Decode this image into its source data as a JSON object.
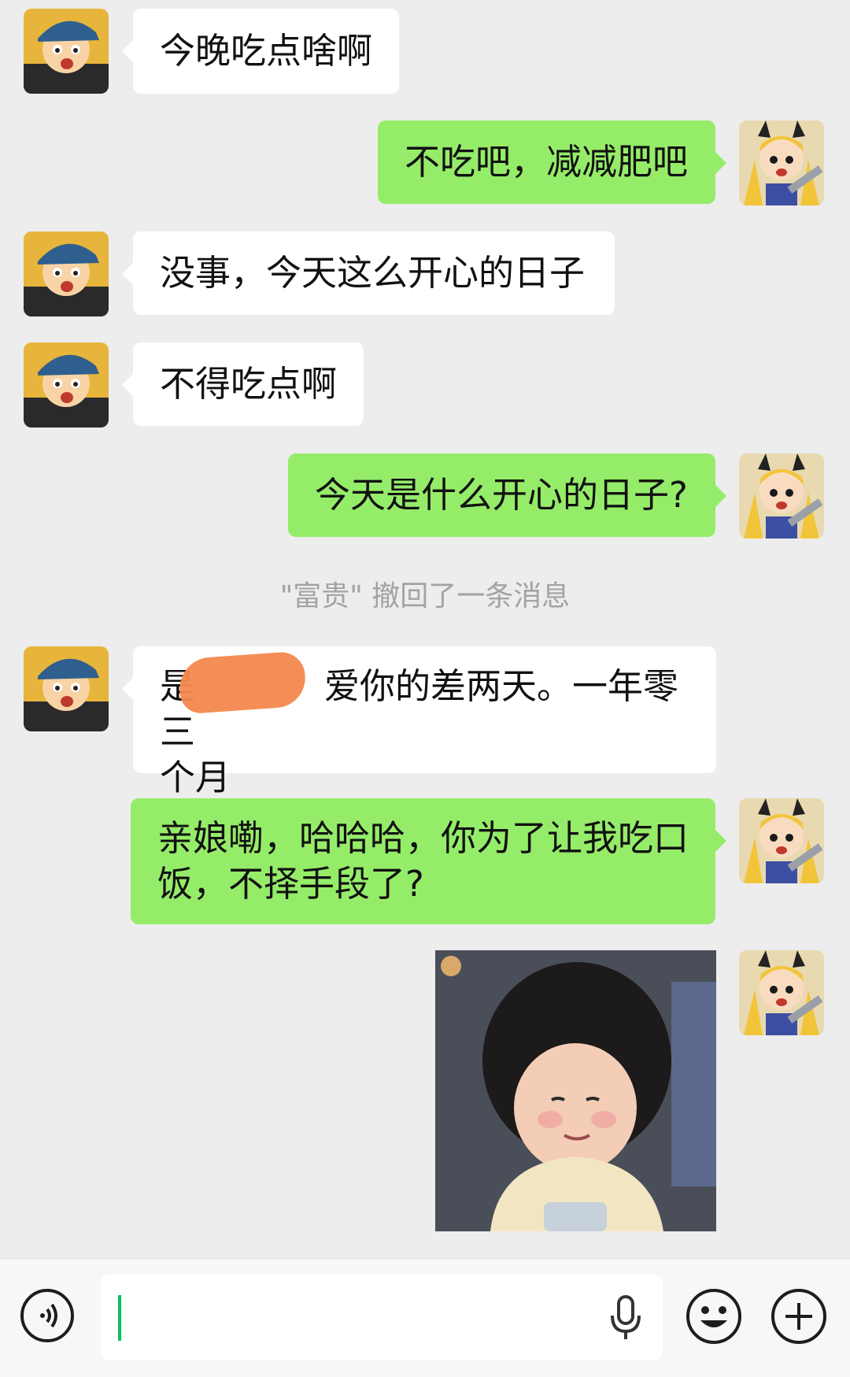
{
  "chat": {
    "messages": [
      {
        "side": "left",
        "lines": [
          "今晚吃点啥啊"
        ]
      },
      {
        "side": "right",
        "lines": [
          "不吃吧，减减肥吧"
        ]
      },
      {
        "side": "left",
        "lines": [
          "没事，今天这么开心的日子"
        ]
      },
      {
        "side": "left",
        "lines": [
          "不得吃点啊"
        ]
      },
      {
        "side": "right",
        "lines": [
          "今天是什么开心的日子?"
        ]
      },
      {
        "side": "left",
        "lines": [
          "是",
          "爱你的差两天。一年零三",
          "个月"
        ]
      },
      {
        "side": "right",
        "lines": [
          "亲娘嘞，哈哈哈，你为了让我吃口",
          "饭，不择手段了?"
        ]
      }
    ],
    "recall_notice": "\"富贵\" 撤回了一条消息"
  },
  "input_bar": {
    "placeholder": "",
    "icons": [
      "voice-icon",
      "microphone-icon",
      "emoji-icon",
      "plus-icon"
    ]
  },
  "colors": {
    "background": "#ededed",
    "sent_bubble": "#95ec69",
    "received_bubble": "#ffffff",
    "caret": "#07c160",
    "redaction": "#f4894f"
  }
}
